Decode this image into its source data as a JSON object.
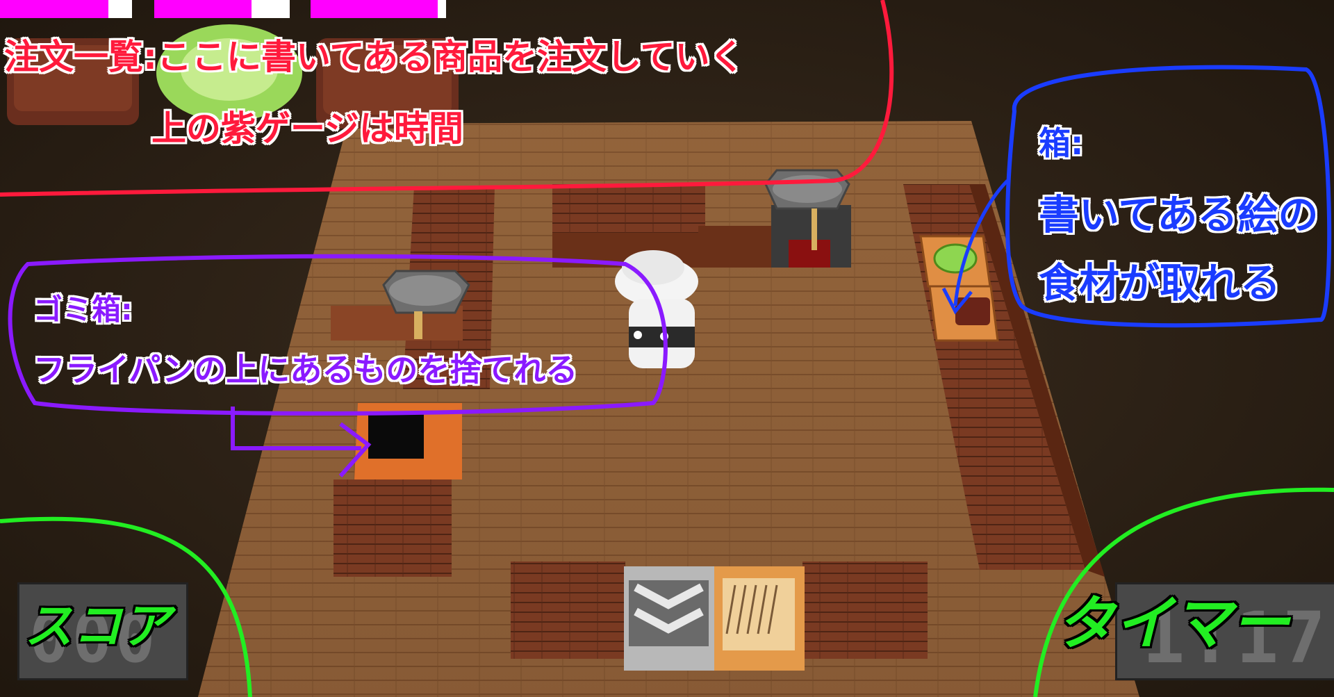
{
  "orders": {
    "timer_bars": [
      {
        "progress": 0.82
      },
      {
        "progress": 0.72
      },
      {
        "progress": 0.94
      }
    ],
    "items": [
      {
        "icon": "meat-icon"
      },
      {
        "icon": "lettuce-icon"
      },
      {
        "icon": "meat-icon"
      }
    ]
  },
  "annotations": {
    "orders_line1": "注文一覧:ここに書いてある商品を注文していく",
    "orders_line2": "上の紫ゲージは時間",
    "box_title": "箱:",
    "box_line1": "書いてある絵の",
    "box_line2": "食材が取れる",
    "trash_title": "ゴミ箱:",
    "trash_line1": "フライパンの上にあるものを捨てれる",
    "score_label": "スコア",
    "timer_label": "タイマー"
  },
  "hud": {
    "score_value": "000",
    "timer_value": "1:17"
  },
  "colors": {
    "order_bar": "#ff00ff",
    "orders_annotation": "#ff1a3c",
    "box_annotation": "#1a3cff",
    "trash_annotation": "#8a1aff",
    "hud_annotation": "#22ee22"
  },
  "icons": [
    "meat-icon",
    "lettuce-icon",
    "frying-pan-icon",
    "chef-icon",
    "trash-bin-icon",
    "ingredient-box-icon",
    "serving-counter-icon",
    "plate-stack-icon"
  ]
}
